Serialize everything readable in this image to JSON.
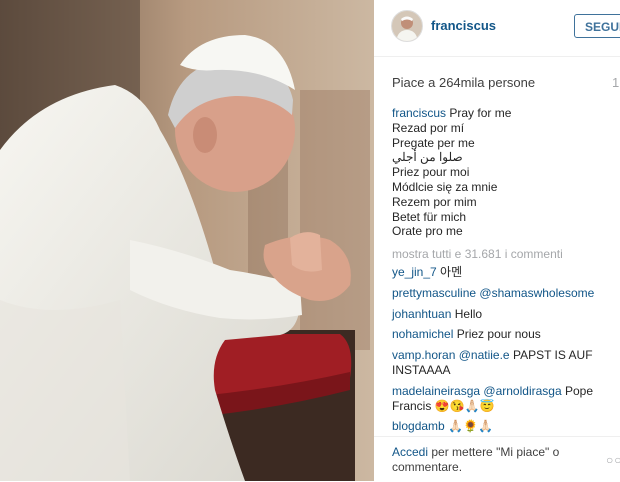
{
  "post": {
    "username": "franciscus",
    "follow_label": "SEGUI",
    "likes": "Piace a 264mila persone",
    "time_partial": "1",
    "caption_lines": [
      "Pray for me",
      "Rezad por mí",
      "Pregate per me",
      "صلوا من أجلي",
      "Priez pour moi",
      "Módlcie się za mnie",
      "Rezem por mim",
      "Betet für mich",
      "Orate pro me"
    ],
    "view_all": "mostra tutti e 31.681 i commenti"
  },
  "comments": [
    {
      "user": "ye_jin_7",
      "mention": "",
      "text": "아멘"
    },
    {
      "user": "prettymasculine",
      "mention": "@shamaswholesome",
      "text": ""
    },
    {
      "user": "johanhtuan",
      "mention": "",
      "text": "Hello"
    },
    {
      "user": "nohamichel",
      "mention": "",
      "text": "Priez pour nous"
    },
    {
      "user": "vamp.horan",
      "mention": "@natiie.e",
      "text": "PAPST IS AUF INSTAAAA"
    },
    {
      "user": "madelaineirasga",
      "mention": "@arnoldirasga",
      "text": "Pope Francis 😍😘🙏🏻😇"
    },
    {
      "user": "blogdamb",
      "mention": "",
      "text": "🙏🏻🌻🙏🏻"
    }
  ],
  "footer": {
    "login_link": "Accedi",
    "login_text": "per mettere \"Mi piace\" o commentare.",
    "more_icon": "more-options-icon"
  },
  "icons": {
    "avatar": "profile-avatar"
  },
  "colors": {
    "link": "#125688",
    "follow": "#3f729b",
    "muted": "#a5a7aa"
  }
}
